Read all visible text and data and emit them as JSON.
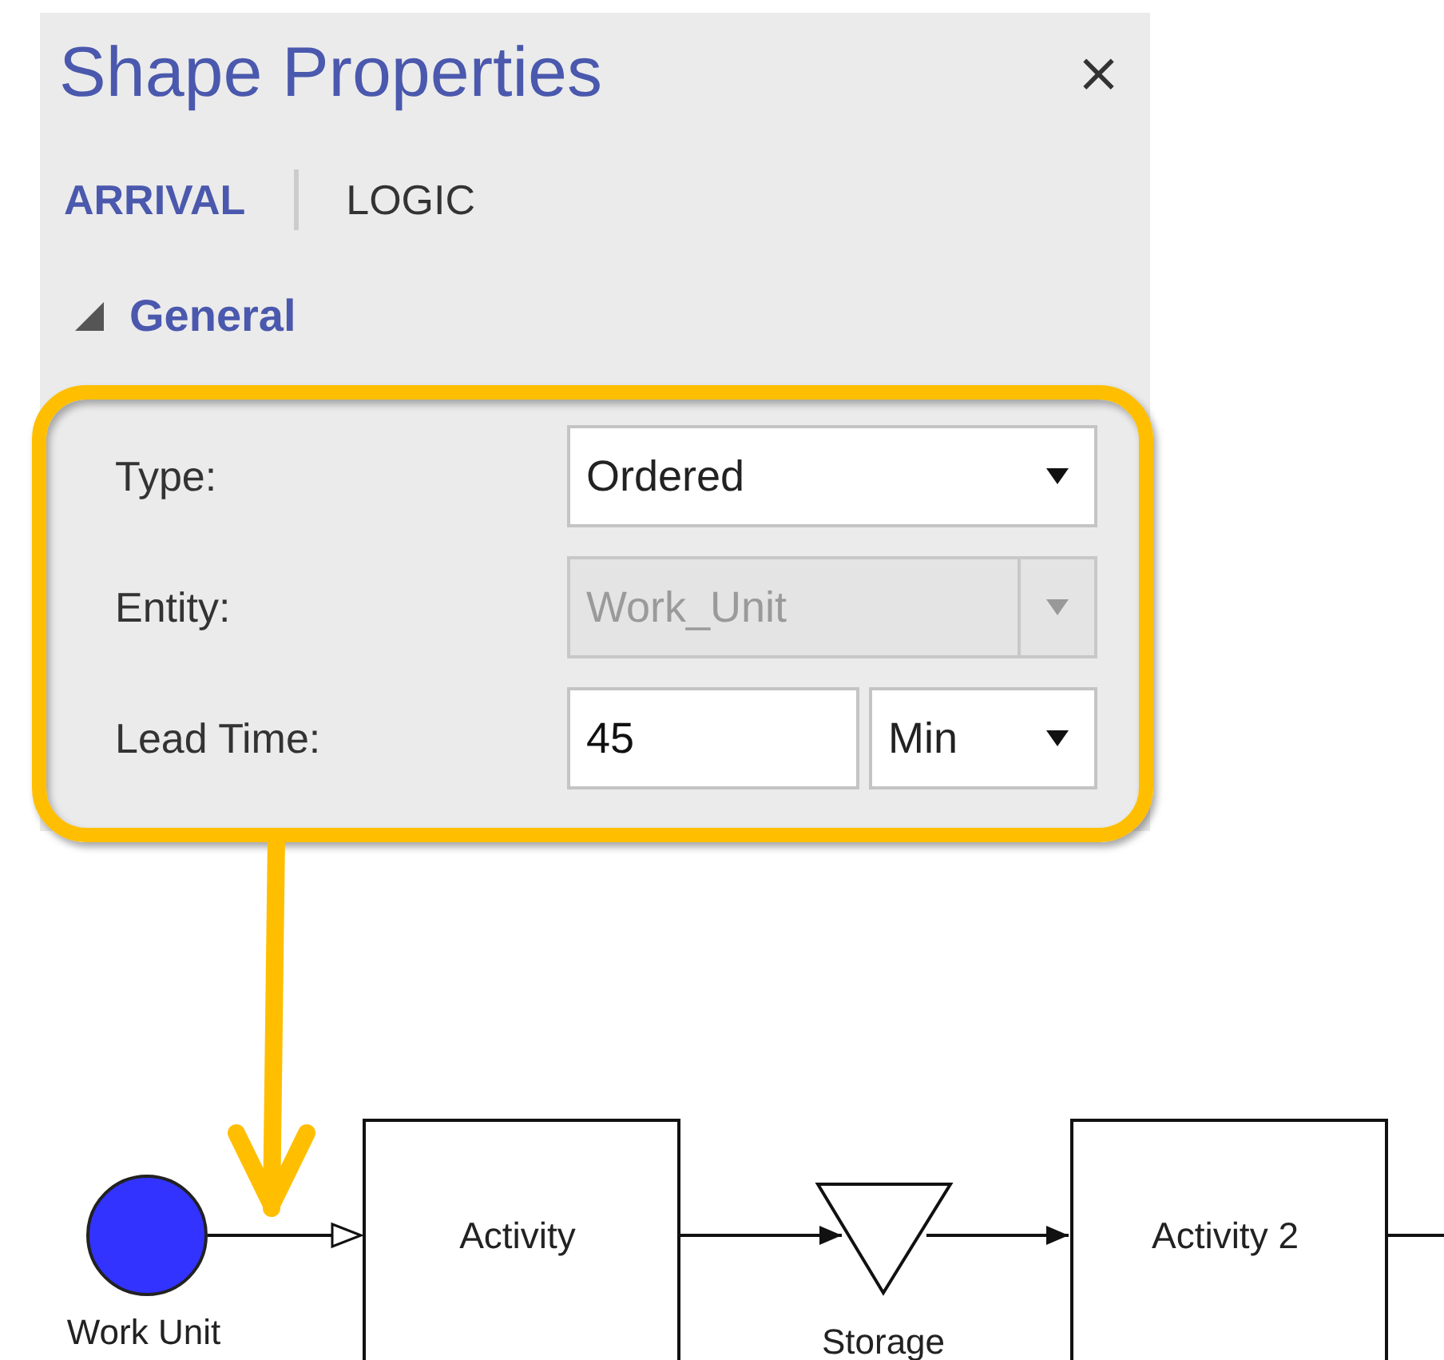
{
  "panel": {
    "title": "Shape Properties",
    "close": "×"
  },
  "tabs": [
    {
      "label": "ARRIVAL",
      "selected": true
    },
    {
      "label": "LOGIC",
      "selected": false
    }
  ],
  "section": {
    "title": "General",
    "expanded": true
  },
  "fields": [
    {
      "kind": "select",
      "label": "Type:",
      "value": "Ordered",
      "disabled": false
    },
    {
      "kind": "select",
      "label": "Entity:",
      "value": "Work_Unit",
      "disabled": true
    },
    {
      "kind": "number_unit",
      "label": "Lead Time:",
      "value": "45",
      "unit": "Min"
    }
  ],
  "diagram": {
    "nodes": [
      {
        "kind": "entity",
        "label": "Work Unit"
      },
      {
        "kind": "activity",
        "label": "Activity"
      },
      {
        "kind": "storage",
        "label": "Storage"
      },
      {
        "kind": "activity",
        "label": "Activity 2"
      }
    ],
    "connectors": [
      {
        "kind": "open_arrow"
      },
      {
        "kind": "filled_arrow"
      },
      {
        "kind": "filled_arrow"
      },
      {
        "kind": "line"
      }
    ]
  }
}
